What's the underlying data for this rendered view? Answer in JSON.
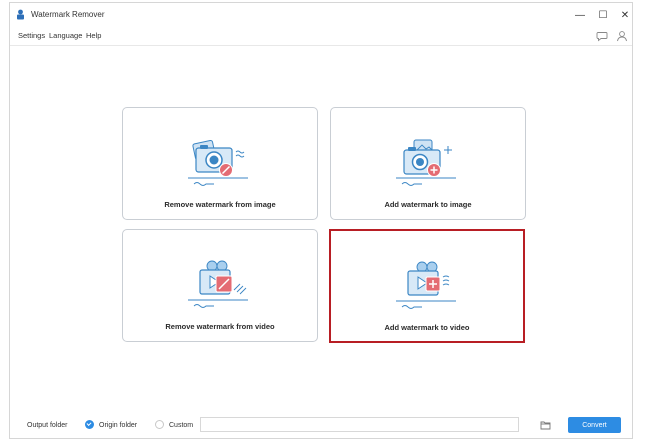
{
  "window": {
    "title": "Watermark Remover",
    "min_symbol": "—",
    "max_symbol": "☐",
    "close_symbol": "✕"
  },
  "menu": {
    "settings": "Settings",
    "language": "Language",
    "help": "Help"
  },
  "toolbar_icons": [
    "chat-bubble-icon",
    "user-icon"
  ],
  "cards": [
    {
      "label": "Remove watermark from image",
      "icon": "camera-remove-icon",
      "selected": false
    },
    {
      "label": "Add watermark to image",
      "icon": "camera-add-icon",
      "selected": false
    },
    {
      "label": "Remove watermark from video",
      "icon": "video-remove-icon",
      "selected": false
    },
    {
      "label": "Add watermark to video",
      "icon": "video-add-icon",
      "selected": true
    }
  ],
  "bottom": {
    "output_folder_label": "Output folder",
    "origin_folder_label": "Origin folder",
    "custom_label": "Custom",
    "path_value": "",
    "selected_option": "Origin folder",
    "convert_label": "Convert"
  },
  "colors": {
    "accent": "#2d8ce3",
    "selected_border": "#b81e24",
    "remove_badge": "#e46b73",
    "illustration_blue": "#3b86c4"
  }
}
